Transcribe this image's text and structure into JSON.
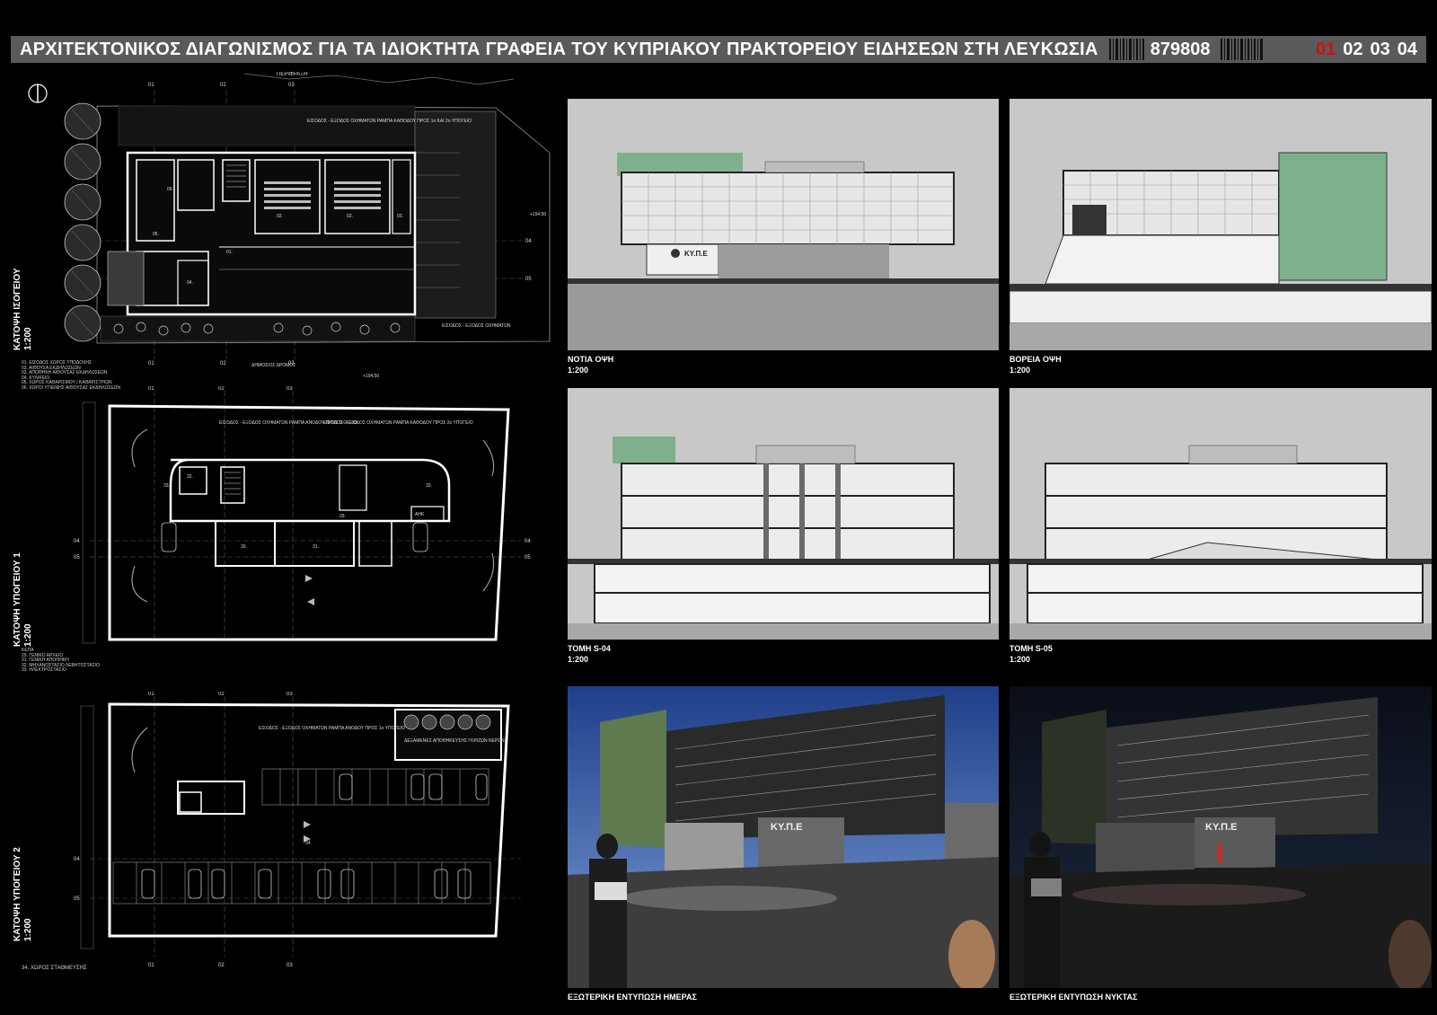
{
  "header": {
    "title": "ΑΡΧΙΤΕΚΤΟΝΙΚΟΣ ΔΙΑΓΩΝΙΣΜΟΣ ΓΙΑ ΤΑ ΙΔΙΟΚΤΗΤΑ ΓΡΑΦΕΙΑ ΤΟΥ ΚΥΠΡΙΑΚΟΥ ΠΡΑΚΤΟΡΕΙΟΥ ΕΙΔΗΣΕΩΝ ΣΤΗ ΛΕΥΚΩΣΙΑ",
    "code": "879808",
    "pages": [
      "01",
      "02",
      "03",
      "04"
    ],
    "active_page": "01",
    "accent_color": "#d01010",
    "bar_color": "#5a5a5a"
  },
  "ground_plan": {
    "label": "ΚΑΤΟΨΗ ΙΣΟΓΕΙΟΥ",
    "scale": "1:200",
    "perimeter_label": "ΠΕΡΙΦΡΑΞΗ",
    "road_label": "ΔΗΜΟΣΙΟΣ ΔΡΟΜΟΣ",
    "entrance_ramp_label": "ΕΙΣΟΔΟΣ - ΕΞΟΔΟΣ ΟΧΗΜΑΤΩΝ ΡΑΜΠΑ ΚΑΘΟΔΟΥ ΠΡΟΣ 1ο ΚΑΙ 2ο ΥΠΟΓΕΙΟ",
    "vehicle_exit_label": "ΕΙΣΟΔΟΣ - ΕΞΟΔΟΣ ΟΧΗΜΑΤΩΝ",
    "elevation_mark_1": "+194.50",
    "elevation_mark_2": "+194.50",
    "grid_top": [
      "01",
      "02",
      "03"
    ],
    "grid_bottom": [
      "01",
      "02",
      "03"
    ],
    "grid_right": [
      "04",
      "05"
    ],
    "rooms": [
      "01.",
      "02.",
      "02.",
      "03.",
      "04.",
      "05.",
      "06."
    ],
    "legend": [
      "01. ΕΙΣΟΔΟΣ ΧΩΡΟΣ ΥΠΟΔΟΧΗΣ",
      "02. ΑΙΘΟΥΣΑ ΕΚΔΗΛΩΣΕΩΝ",
      "03. ΑΠΟΘΗΚΗ ΑΙΘΟΥΣΑΣ ΕΚΔΗΛΩΣΕΩΝ",
      "04. ΚΥΛΙΚΕΙΟ",
      "05. ΧΩΡΟΣ ΚΑΘΑΡΙΣΜΟΥ / ΚΑΘΑΡΙΣΤΡΙΩΝ",
      "06. ΧΩΡΟΙ ΥΓΙΕΙΝΗΣ ΑΙΘΟΥΣΑΣ ΕΚΔΗΛΩΣΕΩΝ"
    ]
  },
  "basement1_plan": {
    "label": "ΚΑΤΟΨΗ ΥΠΟΓΕΙΟΥ 1",
    "scale": "1:200",
    "ramp_down_label": "ΕΙΣΟΔΟΣ - ΕΞΟΔΟΣ ΟΧΗΜΑΤΩΝ ΡΑΜΠΑ ΑΝΟΔΟΥ ΠΡΟΣ ΙΣΟΓΕΙΟ",
    "ramp_up_label": "ΕΙΣΟΔΟΣ - ΕΞΟΔΟΣ ΟΧΗΜΑΤΩΝ ΡΑΜΠΑ ΚΑΘΟΔΟΥ ΠΡΟΣ 2ο ΥΠΟΓΕΙΟ",
    "grid_top": [
      "01",
      "02",
      "03"
    ],
    "grid_left": [
      "04",
      "05"
    ],
    "grid_right": [
      "04",
      "05"
    ],
    "rooms": [
      "32.",
      "33.",
      "29.",
      "30.",
      "31.",
      "33.",
      "ΑΗΚ"
    ],
    "legend": [
      "ΚΕΠΑ",
      "29. ΓΕΝΙΚΟ ΑΡΧΕΙΟ",
      "31. ΓΕΝΙΚΗ ΑΠΟΘΗΚΗ",
      "32. ΜΗΧΑΝΟΣΤΑΣΙΟ ΛΕΒΗΤΟΣΤΑΣΙΟ",
      "33. ΗΛΕΚΤΡΟΣΤΑΣΙΟ"
    ]
  },
  "basement2_plan": {
    "label": "ΚΑΤΟΨΗ ΥΠΟΓΕΙΟΥ 2",
    "scale": "1:200",
    "ramp_label": "ΕΙΣΟΔΟΣ - ΕΞΟΔΟΣ ΟΧΗΜΑΤΩΝ ΡΑΜΠΑ ΑΝΟΔΟΥ ΠΡΟΣ 1ο ΥΠΟΓΕΙΟ",
    "tanks_label": "ΔΕΞΑΜΕΝΕΣ ΑΠΟΘΗΚΕΥΣΗΣ ΓΚΡΙΖΩΝ ΝΕΡΩΝ",
    "room": "34.",
    "grid_top": [
      "01",
      "02",
      "03"
    ],
    "grid_bottom": [
      "01",
      "02",
      "03"
    ],
    "grid_left": [
      "04",
      "05"
    ],
    "legend": [
      "34. ΧΩΡΟΣ ΣΤΑΘΜΕΥΣΗΣ"
    ]
  },
  "drawings": {
    "south_elevation": {
      "title": "ΝΟΤΙΑ ΟΨΗ",
      "scale": "1:200",
      "sign": "ΚΥ.Π.Ε"
    },
    "north_elevation": {
      "title": "ΒΟΡΕΙΑ ΟΨΗ",
      "scale": "1:200"
    },
    "section_s04": {
      "title": "ΤΟΜΗ S-04",
      "scale": "1:200"
    },
    "section_s05": {
      "title": "ΤΟΜΗ S-05",
      "scale": "1:200"
    },
    "render_day": {
      "title": "ΕΞΩΤΕΡΙΚΗ ΕΝΤΥΠΩΣΗ ΗΜΕΡΑΣ",
      "sign": "ΚΥ.Π.Ε"
    },
    "render_night": {
      "title": "ΕΞΩΤΕΡΙΚΗ ΕΝΤΥΠΩΣΗ ΝΥΚΤΑΣ",
      "sign": "ΚΥ.Π.Ε"
    }
  },
  "icons": {
    "north_arrow": "north-arrow-icon"
  }
}
